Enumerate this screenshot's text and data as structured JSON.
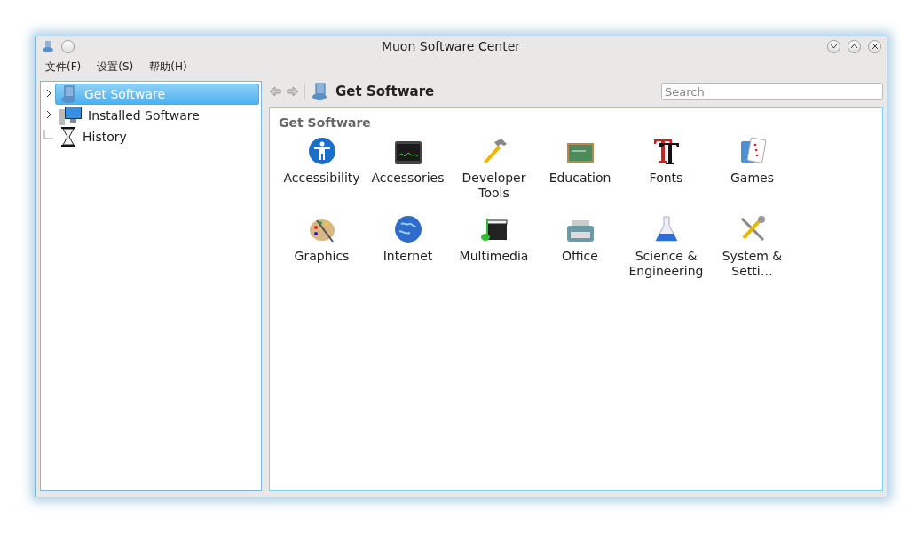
{
  "window": {
    "title": "Muon Software Center"
  },
  "menu": [
    "文件(F)",
    "设置(S)",
    "帮助(H)"
  ],
  "sidebar": {
    "items": [
      {
        "label": "Get Software",
        "kind": "get",
        "selected": true,
        "expanded": false
      },
      {
        "label": "Installed Software",
        "kind": "installed",
        "selected": false,
        "expanded": false
      },
      {
        "label": "History",
        "kind": "history",
        "selected": false
      }
    ]
  },
  "toolbar": {
    "title": "Get Software",
    "search": {
      "placeholder": "Search"
    }
  },
  "panel": {
    "heading": "Get Software",
    "categories": [
      {
        "label": "Accessibility",
        "kind": "accessibility"
      },
      {
        "label": "Accessories",
        "kind": "accessories"
      },
      {
        "label": "Developer Tools",
        "kind": "developer"
      },
      {
        "label": "Education",
        "kind": "education"
      },
      {
        "label": "Fonts",
        "kind": "fonts"
      },
      {
        "label": "Games",
        "kind": "games"
      },
      {
        "label": "Graphics",
        "kind": "graphics"
      },
      {
        "label": "Internet",
        "kind": "internet"
      },
      {
        "label": "Multimedia",
        "kind": "multimedia"
      },
      {
        "label": "Office",
        "kind": "office"
      },
      {
        "label": "Science & Engineering",
        "kind": "science"
      },
      {
        "label": "System & Setti…",
        "kind": "system"
      }
    ]
  }
}
